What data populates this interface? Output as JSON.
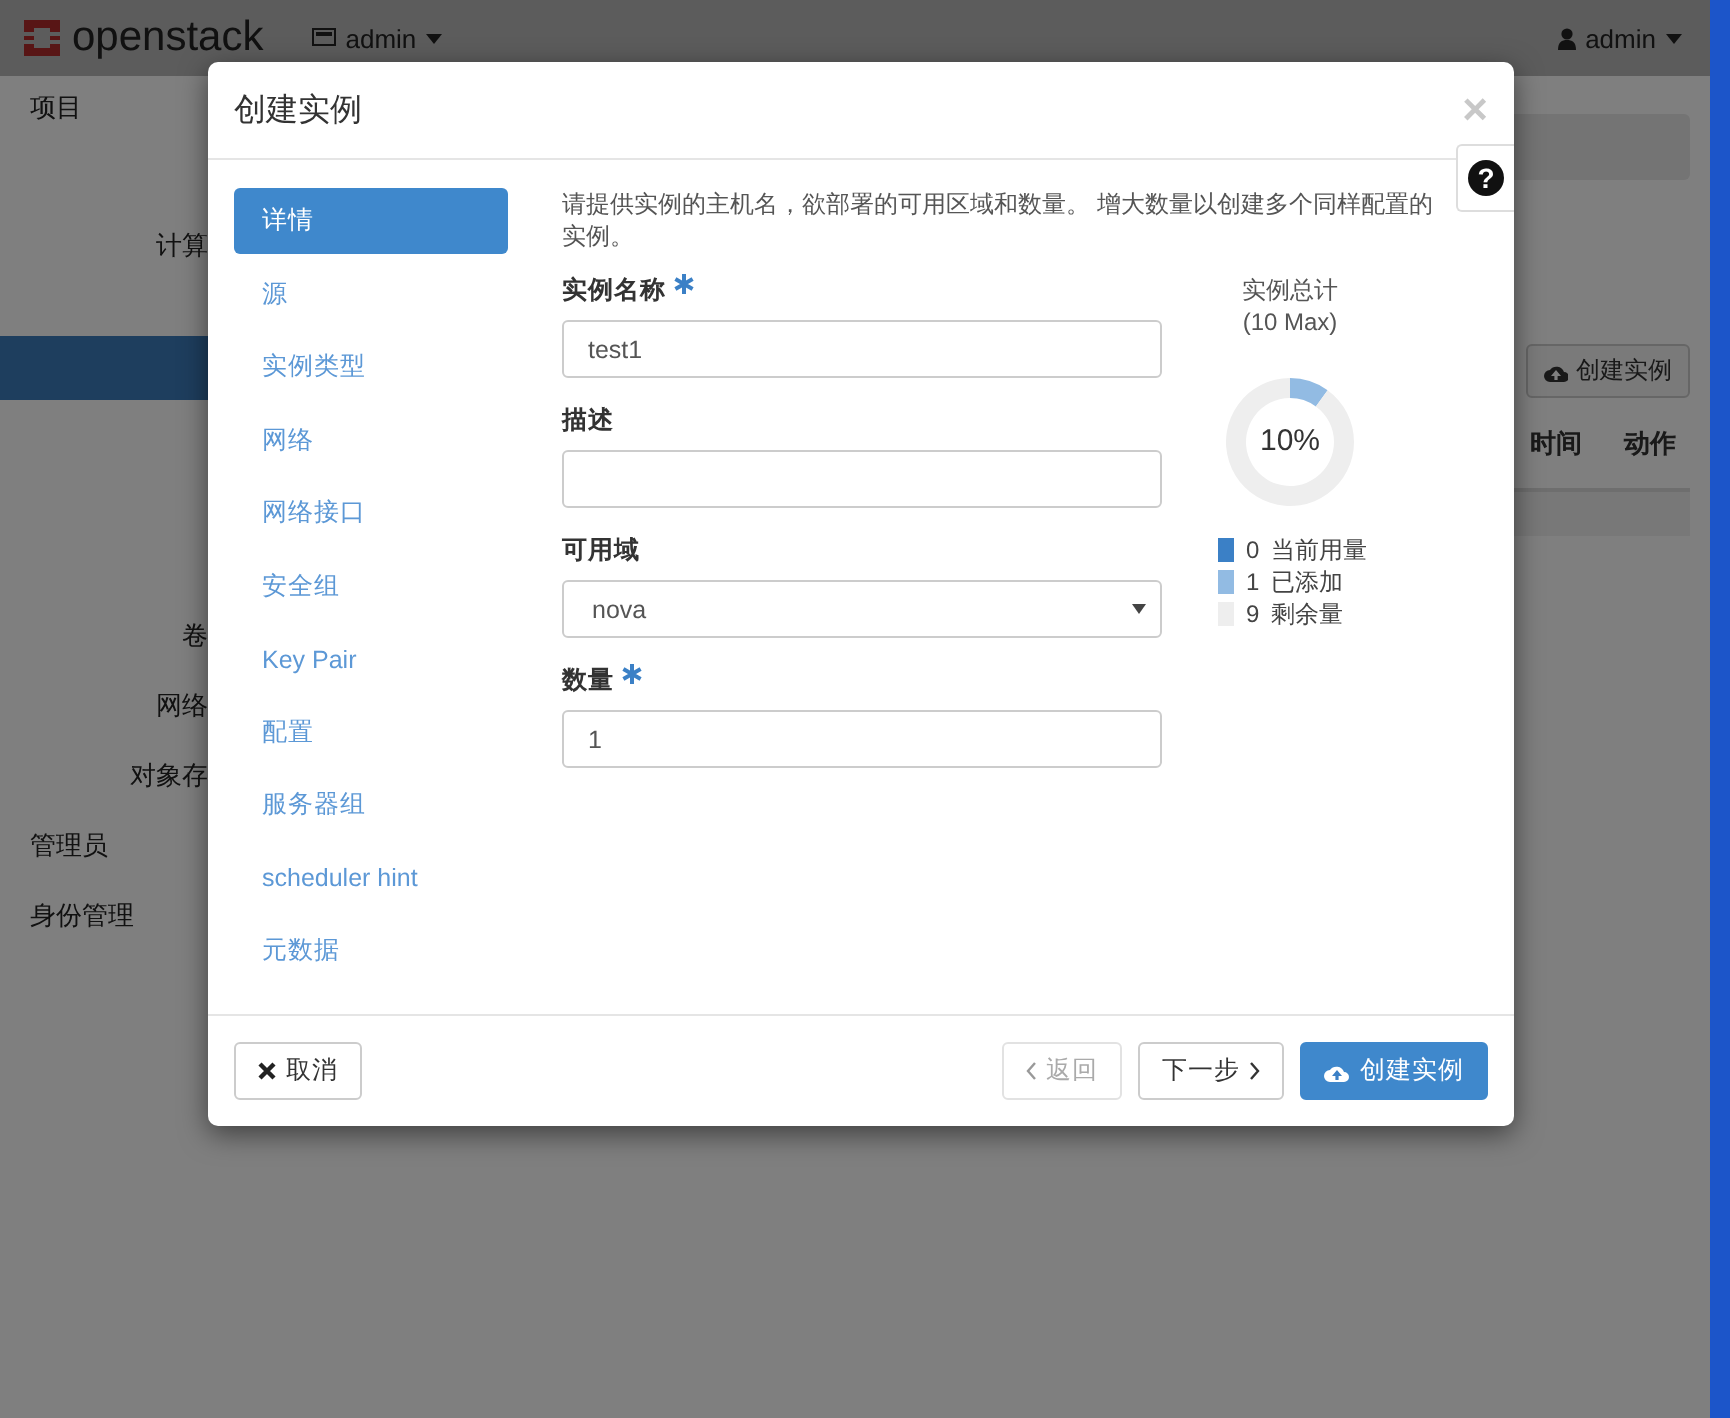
{
  "page": {
    "logo": "openstack",
    "project_menu": "admin",
    "user_menu": "admin",
    "sidebar": [
      {
        "label": "项目",
        "kind": "section",
        "selected": false
      },
      {
        "label": "计算",
        "kind": "sub",
        "selected": false
      },
      {
        "kind": "bar",
        "selected": true
      },
      {
        "label": "卷",
        "kind": "sub",
        "selected": false
      },
      {
        "label": "网络",
        "kind": "sub",
        "selected": false
      },
      {
        "label": "对象存",
        "kind": "sub",
        "selected": false
      },
      {
        "label": "管理员",
        "kind": "section",
        "selected": false
      },
      {
        "label": "身份管理",
        "kind": "section",
        "selected": false
      }
    ],
    "create_button": "创建实例",
    "table_columns": [
      "时间",
      "动作"
    ]
  },
  "modal": {
    "title": "创建实例",
    "close": "×",
    "help": "?",
    "nav": [
      {
        "label": "详情",
        "selected": true
      },
      {
        "label": "源",
        "selected": false
      },
      {
        "label": "实例类型",
        "selected": false
      },
      {
        "label": "网络",
        "selected": false
      },
      {
        "label": "网络接口",
        "selected": false
      },
      {
        "label": "安全组",
        "selected": false
      },
      {
        "label": "Key Pair",
        "selected": false
      },
      {
        "label": "配置",
        "selected": false
      },
      {
        "label": "服务器组",
        "selected": false
      },
      {
        "label": "scheduler hint",
        "selected": false
      },
      {
        "label": "元数据",
        "selected": false
      }
    ],
    "description": "请提供实例的主机名，欲部署的可用区域和数量。 增大数量以创建多个同样配置的实例。",
    "fields": [
      {
        "label": "实例名称",
        "required": true,
        "kind": "text",
        "value": "test1"
      },
      {
        "label": "描述",
        "required": false,
        "kind": "text"
      },
      {
        "label": "可用域",
        "required": false,
        "kind": "select",
        "value": "nova"
      },
      {
        "label": "数量",
        "required": true,
        "kind": "text",
        "value": "1"
      }
    ],
    "quota": {
      "title": "实例总计",
      "max": "(10 Max)",
      "percent": "10%",
      "legend": [
        {
          "count": "0",
          "label": "当前用量",
          "color": "#3b80c6"
        },
        {
          "count": "1",
          "label": "已添加",
          "color": "#92bbe3"
        },
        {
          "count": "9",
          "label": "剩余量",
          "color": "#eeeeee"
        }
      ]
    },
    "buttons": [
      {
        "label": "取消",
        "kind": "cancel",
        "disabled": false
      },
      {
        "label": "返回",
        "kind": "back",
        "disabled": true
      },
      {
        "label": "下一步",
        "kind": "next",
        "disabled": false
      },
      {
        "label": "创建实例",
        "kind": "launch",
        "disabled": false
      }
    ]
  }
}
